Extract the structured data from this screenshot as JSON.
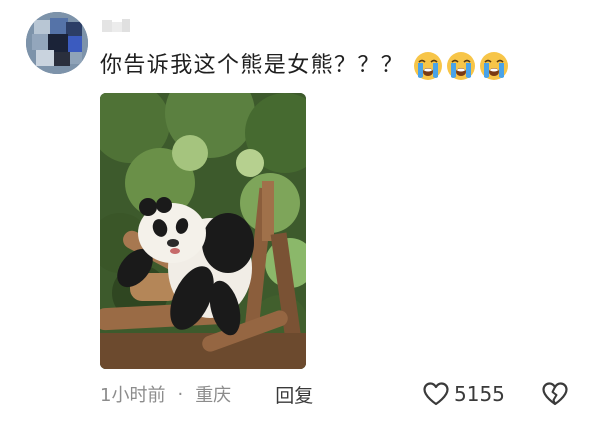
{
  "comment": {
    "username": "",
    "text": "你告诉我这个熊是女熊？？？",
    "emojis": [
      "crying-face-emoji",
      "crying-face-emoji",
      "crying-face-emoji"
    ],
    "image": {
      "subject": "giant-panda-photo"
    },
    "meta": {
      "time": "1小时前",
      "separator": "·",
      "location": "重庆",
      "reply_label": "回复"
    },
    "actions": {
      "like_icon": "heart-outline-icon",
      "like_count": "5155",
      "dislike_icon": "broken-heart-icon"
    }
  },
  "colors": {
    "text": "#1f1f1f",
    "meta_text": "#8c8c8c",
    "action_text": "#3a3a3a",
    "emoji_face": "#f7c548",
    "emoji_tears": "#4aa3e8"
  }
}
